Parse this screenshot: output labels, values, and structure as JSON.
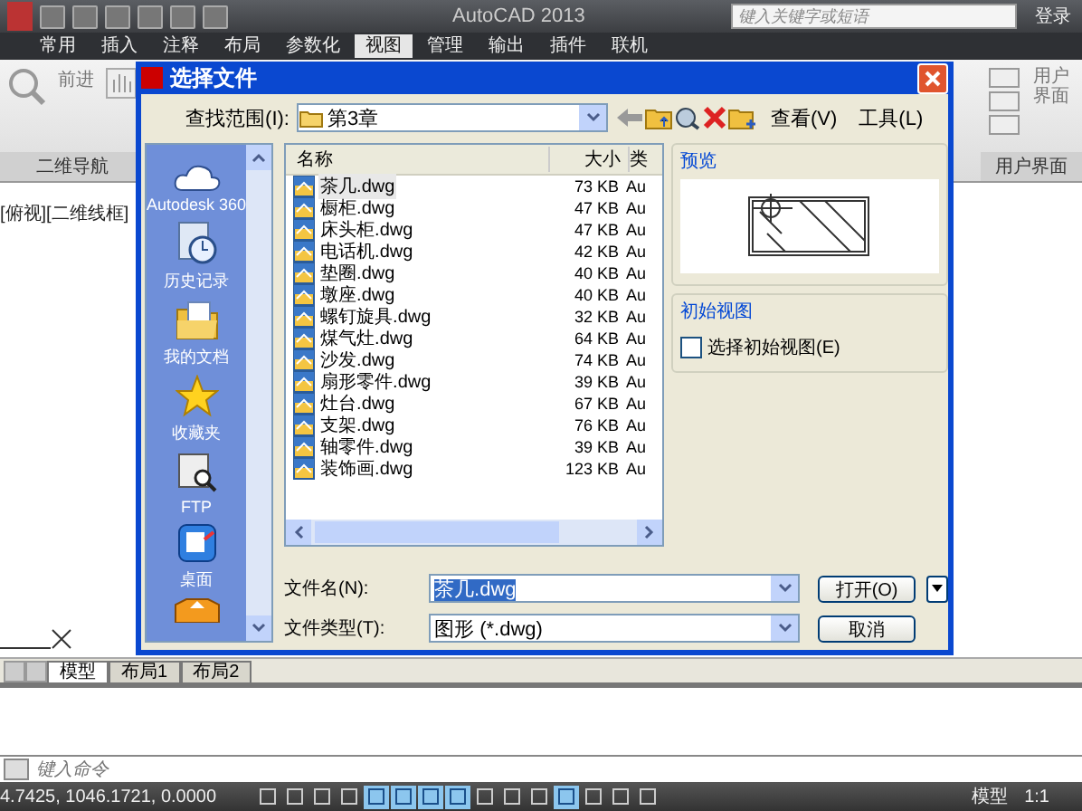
{
  "app": {
    "title": "AutoCAD 2013",
    "search": {
      "placeholder": "键入关键字或短语"
    },
    "login": "登录",
    "menu_tabs": [
      {
        "label": "常用",
        "selected": false
      },
      {
        "label": "插入",
        "selected": false
      },
      {
        "label": "注释",
        "selected": false
      },
      {
        "label": "布局",
        "selected": false
      },
      {
        "label": "参数化",
        "selected": false
      },
      {
        "label": "视图",
        "selected": true
      },
      {
        "label": "管理",
        "selected": false
      },
      {
        "label": "输出",
        "selected": false
      },
      {
        "label": "插件",
        "selected": false
      },
      {
        "label": "联机",
        "selected": false
      }
    ],
    "ribbon": {
      "left_button": "前进",
      "left_panel": "二维导航",
      "right_button": "用户界面",
      "right_panel": "用户界面"
    },
    "viewport_label": "[俯视][二维线框]",
    "layout_tabs": [
      {
        "label": "模型",
        "selected": true
      },
      {
        "label": "布局1",
        "selected": false
      },
      {
        "label": "布局2",
        "selected": false
      }
    ],
    "command": {
      "placeholder": "键入命令"
    },
    "status_bar": {
      "coordinates": "4.7425, 1046.1721, 0.0000",
      "toggles": [
        {
          "on": false
        },
        {
          "on": false
        },
        {
          "on": false
        },
        {
          "on": false
        },
        {
          "on": true
        },
        {
          "on": true
        },
        {
          "on": true
        },
        {
          "on": true
        },
        {
          "on": false
        },
        {
          "on": false
        },
        {
          "on": false
        },
        {
          "on": true
        },
        {
          "on": false
        },
        {
          "on": false
        },
        {
          "on": false
        }
      ],
      "model_button": "模型",
      "scale": "1:1"
    }
  },
  "dialog": {
    "title": "选择文件",
    "look_in_label": "查找范围(I):",
    "look_in": "第3章",
    "view_menu": "查看(V)",
    "tools_menu": "工具(L)",
    "places": [
      {
        "kind": "cloud",
        "label": "Autodesk 360"
      },
      {
        "kind": "history",
        "label": "历史记录"
      },
      {
        "kind": "documents",
        "label": "我的文档"
      },
      {
        "kind": "favorites",
        "label": "收藏夹"
      },
      {
        "kind": "ftp",
        "label": "FTP"
      },
      {
        "kind": "desktop",
        "label": "桌面"
      },
      {
        "kind": "folder"
      }
    ],
    "columns": [
      "名称",
      "大小",
      "类"
    ],
    "files": [
      {
        "name": "茶几.dwg",
        "size": "73 KB",
        "type": "Au",
        "selected": true
      },
      {
        "name": "橱柜.dwg",
        "size": "47 KB",
        "type": "Au",
        "selected": false
      },
      {
        "name": "床头柜.dwg",
        "size": "47 KB",
        "type": "Au",
        "selected": false
      },
      {
        "name": "电话机.dwg",
        "size": "42 KB",
        "type": "Au",
        "selected": false
      },
      {
        "name": "垫圈.dwg",
        "size": "40 KB",
        "type": "Au",
        "selected": false
      },
      {
        "name": "墩座.dwg",
        "size": "40 KB",
        "type": "Au",
        "selected": false
      },
      {
        "name": "螺钉旋具.dwg",
        "size": "32 KB",
        "type": "Au",
        "selected": false
      },
      {
        "name": "煤气灶.dwg",
        "size": "64 KB",
        "type": "Au",
        "selected": false
      },
      {
        "name": "沙发.dwg",
        "size": "74 KB",
        "type": "Au",
        "selected": false
      },
      {
        "name": "扇形零件.dwg",
        "size": "39 KB",
        "type": "Au",
        "selected": false
      },
      {
        "name": "灶台.dwg",
        "size": "67 KB",
        "type": "Au",
        "selected": false
      },
      {
        "name": "支架.dwg",
        "size": "76 KB",
        "type": "Au",
        "selected": false
      },
      {
        "name": "轴零件.dwg",
        "size": "39 KB",
        "type": "Au",
        "selected": false
      },
      {
        "name": "装饰画.dwg",
        "size": "123 KB",
        "type": "Au",
        "selected": false
      }
    ],
    "preview_label": "预览",
    "initial_view_group": "初始视图",
    "initial_view": {
      "label": "选择初始视图(E)",
      "checked": false
    },
    "file_name_label": "文件名(N):",
    "file_name": "茶几.dwg",
    "file_type_label": "文件类型(T):",
    "file_type": "图形 (*.dwg)",
    "open_button": "打开(O)",
    "cancel_button": "取消"
  }
}
